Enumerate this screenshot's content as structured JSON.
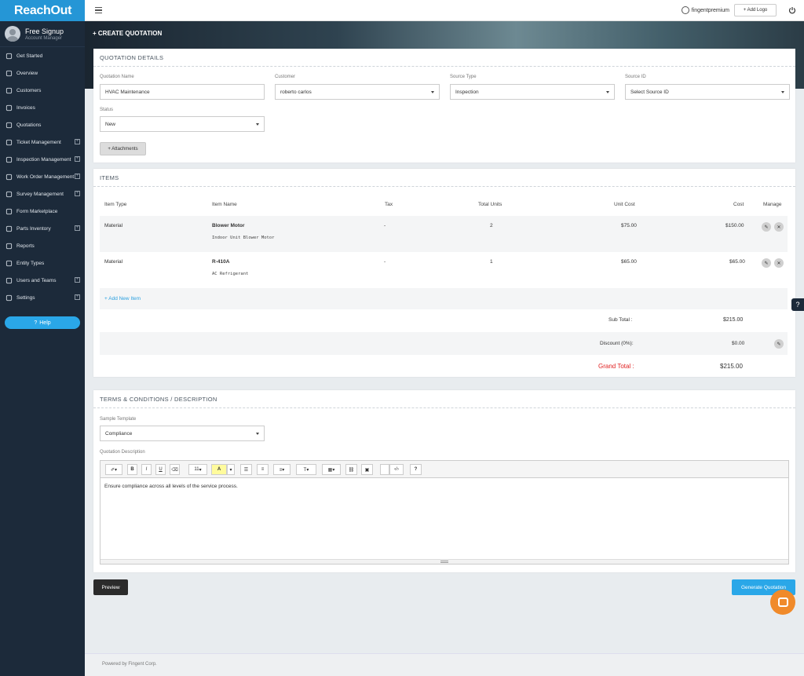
{
  "app": {
    "logo_text": "ReachOut"
  },
  "profile": {
    "name": "Free Signup",
    "role": "Account Manager"
  },
  "sidebar": {
    "items": [
      {
        "label": "Get Started",
        "icon": "rocket-icon",
        "expand": false
      },
      {
        "label": "Overview",
        "icon": "dashboard-icon",
        "expand": false
      },
      {
        "label": "Customers",
        "icon": "users-icon",
        "expand": false
      },
      {
        "label": "Invoices",
        "icon": "invoice-icon",
        "expand": false
      },
      {
        "label": "Quotations",
        "icon": "quotation-icon",
        "expand": false
      },
      {
        "label": "Ticket Management",
        "icon": "ticket-icon",
        "expand": true
      },
      {
        "label": "Inspection Management",
        "icon": "clipboard-icon",
        "expand": true
      },
      {
        "label": "Work Order Management",
        "icon": "wrench-icon",
        "expand": true
      },
      {
        "label": "Survey Management",
        "icon": "survey-icon",
        "expand": true
      },
      {
        "label": "Form Marketplace",
        "icon": "form-icon",
        "expand": false
      },
      {
        "label": "Parts Inventory",
        "icon": "box-icon",
        "expand": true
      },
      {
        "label": "Reports",
        "icon": "report-icon",
        "expand": false
      },
      {
        "label": "Entity Types",
        "icon": "entity-icon",
        "expand": false
      },
      {
        "label": "Users and Teams",
        "icon": "user-icon",
        "expand": true
      },
      {
        "label": "Settings",
        "icon": "gear-icon",
        "expand": true
      }
    ],
    "help_label": "Help"
  },
  "topbar": {
    "username": "fingentpremium",
    "add_logo": "+ Add Logo"
  },
  "page": {
    "title": "+ CREATE QUOTATION"
  },
  "quotation_details": {
    "header": "QUOTATION DETAILS",
    "name_label": "Quotation Name",
    "name_value": "HVAC Maintenance",
    "customer_label": "Customer",
    "customer_value": "roberto carlos",
    "source_type_label": "Source Type",
    "source_type_value": "Inspection",
    "source_id_label": "Source ID",
    "source_id_value": "Select Source ID",
    "status_label": "Status",
    "status_value": "New",
    "attachments": "+ Attachments"
  },
  "items": {
    "header": "ITEMS",
    "columns": {
      "type": "Item Type",
      "name": "Item Name",
      "tax": "Tax",
      "units": "Total Units",
      "unit_cost": "Unit Cost",
      "cost": "Cost",
      "manage": "Manage"
    },
    "rows": [
      {
        "type": "Material",
        "name": "Blower Motor",
        "desc": "Indoor Unit Blower Motor",
        "tax": "-",
        "units": "2",
        "unit_cost": "$75.00",
        "cost": "$150.00"
      },
      {
        "type": "Material",
        "name": "R-410A",
        "desc": "AC Refrigerant",
        "tax": "-",
        "units": "1",
        "unit_cost": "$65.00",
        "cost": "$65.00"
      }
    ],
    "add_new": "+ Add New Item",
    "subtotal_label": "Sub Total :",
    "subtotal_value": "$215.00",
    "discount_label": "Discount (0%):",
    "discount_value": "$0.00",
    "grand_label": "Grand Total :",
    "grand_value": "$215.00",
    "accent_red": "#e02020"
  },
  "terms": {
    "header": "TERMS & CONDITIONS / DESCRIPTION",
    "template_label": "Sample Template",
    "template_value": "Compliance",
    "desc_label": "Quotation Description",
    "font_size": "11",
    "editor_text": "Ensure compliance across all levels of the service process."
  },
  "actions": {
    "preview": "Preview",
    "generate": "Generate Quotation"
  },
  "footer": {
    "text": "Powered by Fingent Corp."
  }
}
